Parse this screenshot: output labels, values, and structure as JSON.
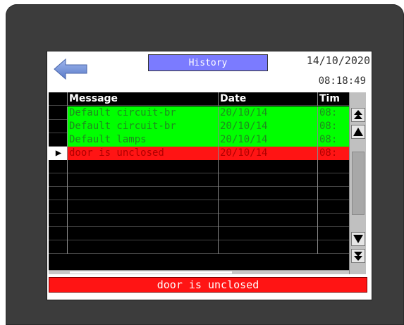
{
  "header": {
    "title_label": "History",
    "date": "14/10/2020",
    "time": "08:18:49"
  },
  "back_button": {
    "icon": "arrow-left-icon",
    "color": "#6f8fd8"
  },
  "table": {
    "columns": [
      "Message",
      "Date",
      "Tim"
    ],
    "rows": [
      {
        "message": "Default circuit-br",
        "date": "20/10/14",
        "time": "08:",
        "status": "green",
        "selected": false
      },
      {
        "message": "Default circuit-br",
        "date": "20/10/14",
        "time": "08:",
        "status": "green",
        "selected": false
      },
      {
        "message": "Default lamps",
        "date": "20/10/14",
        "time": "08:",
        "status": "green",
        "selected": false
      },
      {
        "message": "door is unclosed",
        "date": "20/10/14",
        "time": "08:",
        "status": "red",
        "selected": true
      }
    ],
    "empty_rows": 7,
    "selection_marker": "▶"
  },
  "scrollbar": {
    "top_icon": "double-up-arrow-icon",
    "up_icon": "up-arrow-icon",
    "down_icon": "down-arrow-icon",
    "bottom_icon": "double-down-arrow-icon"
  },
  "status_bar": {
    "message": "door is unclosed"
  },
  "colors": {
    "bezel": "#3c3c3c",
    "title_button": "#7b7bff",
    "ok_row": "#00ff00",
    "alarm_row": "#ff1414"
  }
}
